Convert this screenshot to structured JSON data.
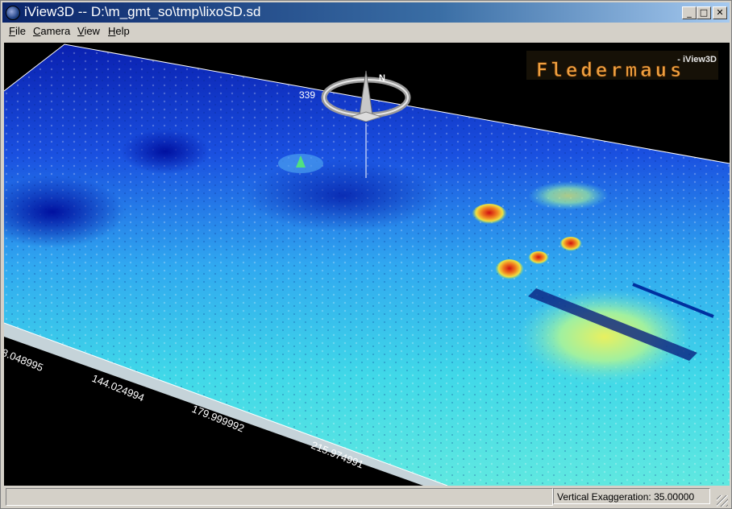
{
  "window": {
    "title": "iView3D -- D:\\m_gmt_so\\tmp\\lixoSD.sd",
    "icon": "globe-icon",
    "controls": {
      "minimize": "_",
      "maximize": "□",
      "close": "✕"
    }
  },
  "menu": {
    "items": [
      {
        "label": "File",
        "accel": "F",
        "rest": "ile"
      },
      {
        "label": "Camera",
        "accel": "C",
        "rest": "amera"
      },
      {
        "label": "View",
        "accel": "V",
        "rest": "iew"
      },
      {
        "label": "Help",
        "accel": "H",
        "rest": "elp"
      }
    ]
  },
  "scene": {
    "logo_sub": "- iView3D",
    "logo_main": "Fledermaus",
    "compass_heading": "339",
    "compass_north": "N",
    "axis_labels": [
      "8.048995",
      "144.024994",
      "179.999992",
      "215.974991"
    ]
  },
  "status": {
    "left_text": "",
    "vertical_exaggeration": "Vertical Exaggeration: 35.00000"
  },
  "colors": {
    "title_start": "#0a246a",
    "title_end": "#a6caf0",
    "terrain_deep": "#1530c8",
    "terrain_mid": "#22c0e0",
    "terrain_high": "#e0e050",
    "terrain_peak": "#d01010"
  }
}
